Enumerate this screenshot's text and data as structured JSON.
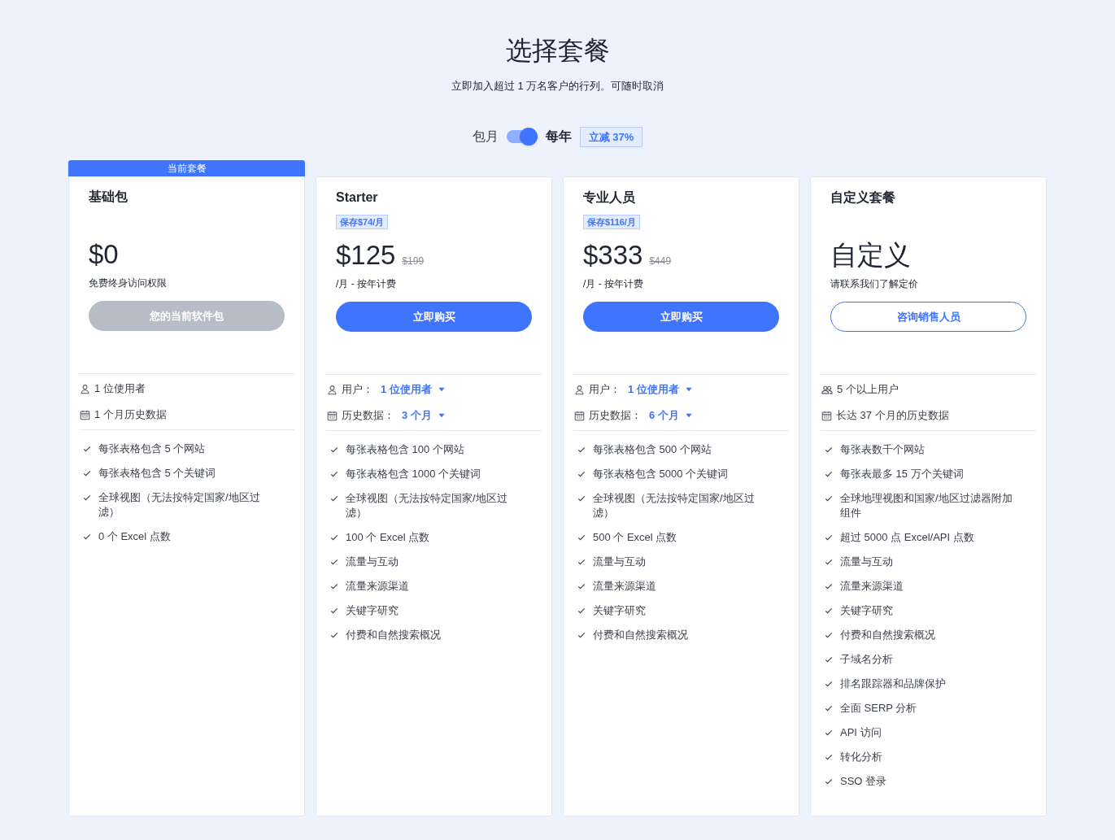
{
  "header": {
    "title": "选择套餐",
    "subtitle": "立即加入超过 1 万名客户的行列。可随时取消"
  },
  "billing_toggle": {
    "left_label": "包月",
    "on": true,
    "right_label": "每年",
    "discount": "立减 37%"
  },
  "plans": [
    {
      "banner": "当前套餐",
      "name": "基础包",
      "price": "$0",
      "note": "免费终身访问权限",
      "button": {
        "label": "您的当前软件包",
        "kind": "disabled"
      },
      "users": {
        "kind": "single",
        "text": "1 位使用者"
      },
      "history": {
        "kind": "plain",
        "text": "1 个月历史数据"
      },
      "features": [
        "每张表格包含 5 个网站",
        "每张表格包含 5 个关键词",
        "全球视图（无法按特定国家/地区过滤）",
        "0 个 Excel 点数"
      ]
    },
    {
      "name": "Starter",
      "save_badge": "保存$74/月",
      "price": "$125",
      "original_price": "$199",
      "note": "/月 - 按年计费",
      "button": {
        "label": "立即购买",
        "kind": "primary"
      },
      "users": {
        "kind": "select",
        "label": "用户：",
        "value": "1 位使用者"
      },
      "history": {
        "kind": "select",
        "label": "历史数据：",
        "value": "3 个月"
      },
      "features": [
        "每张表格包含 100 个网站",
        "每张表格包含 1000 个关键词",
        "全球视图（无法按特定国家/地区过滤）",
        "100 个 Excel 点数",
        "流量与互动",
        "流量来源渠道",
        "关键字研究",
        "付费和自然搜索概况"
      ]
    },
    {
      "name": "专业人员",
      "save_badge": "保存$116/月",
      "price": "$333",
      "original_price": "$449",
      "note": "/月 - 按年计费",
      "button": {
        "label": "立即购买",
        "kind": "primary"
      },
      "users": {
        "kind": "select",
        "label": "用户：",
        "value": "1 位使用者"
      },
      "history": {
        "kind": "select",
        "label": "历史数据：",
        "value": "6 个月"
      },
      "features": [
        "每张表格包含 500 个网站",
        "每张表格包含 5000 个关键词",
        "全球视图（无法按特定国家/地区过滤）",
        "500 个 Excel 点数",
        "流量与互动",
        "流量来源渠道",
        "关键字研究",
        "付费和自然搜索概况"
      ]
    },
    {
      "name": "自定义套餐",
      "price": "自定义",
      "note": "请联系我们了解定价",
      "button": {
        "label": "咨询销售人员",
        "kind": "outline"
      },
      "users": {
        "kind": "group",
        "text": "5 个以上用户"
      },
      "history": {
        "kind": "plain",
        "text": "长达 37 个月的历史数据"
      },
      "features": [
        "每张表数千个网站",
        "每张表最多 15 万个关键词",
        "全球地理视图和国家/地区过滤器附加组件",
        "超过 5000 点 Excel/API 点数",
        "流量与互动",
        "流量来源渠道",
        "关键字研究",
        "付费和自然搜索概况",
        "子域名分析",
        "排名跟踪器和品牌保护",
        "全面 SERP 分析",
        "API 访问",
        "转化分析",
        "SSO 登录"
      ]
    }
  ]
}
